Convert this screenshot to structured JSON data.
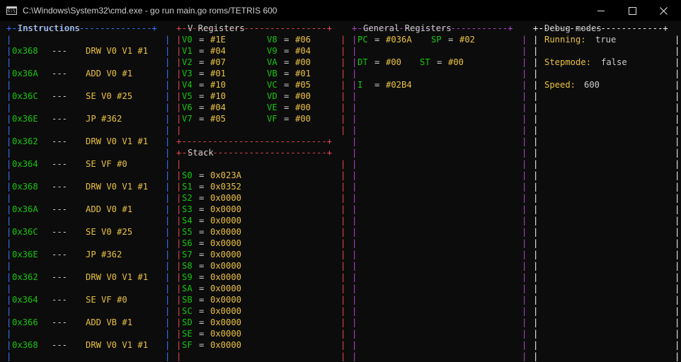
{
  "window": {
    "title": "C:\\Windows\\System32\\cmd.exe - go  run main.go roms/TETRIS 600",
    "icon": "console-icon",
    "icon_glyph": "C:\\",
    "controls": [
      "minimize-icon",
      "maximize-icon",
      "close-icon"
    ]
  },
  "colors": {
    "instructions_border": "#3b78ff",
    "v_registers_border": "#e74856",
    "general_registers_border": "#b148c6",
    "debug_border": "#f2f2f2",
    "address": "#16c60c",
    "value": "#e9c043",
    "text": "#cccccc"
  },
  "instructions": {
    "title": "Instructions",
    "separator": "---",
    "rows": [
      {
        "addr": "0x368",
        "op": "DRW V0 V1 #1"
      },
      {
        "addr": "0x36A",
        "op": "ADD V0 #1"
      },
      {
        "addr": "0x36C",
        "op": "SE V0 #25"
      },
      {
        "addr": "0x36E",
        "op": "JP #362"
      },
      {
        "addr": "0x362",
        "op": "DRW V0 V1 #1"
      },
      {
        "addr": "0x364",
        "op": "SE VF #0"
      },
      {
        "addr": "0x368",
        "op": "DRW V0 V1 #1"
      },
      {
        "addr": "0x36A",
        "op": "ADD V0 #1"
      },
      {
        "addr": "0x36C",
        "op": "SE V0 #25"
      },
      {
        "addr": "0x36E",
        "op": "JP #362"
      },
      {
        "addr": "0x362",
        "op": "DRW V0 V1 #1"
      },
      {
        "addr": "0x364",
        "op": "SE VF #0"
      },
      {
        "addr": "0x366",
        "op": "ADD VB #1"
      },
      {
        "addr": "0x368",
        "op": "DRW V0 V1 #1"
      }
    ]
  },
  "v_registers": {
    "title": "V Registers",
    "left": [
      {
        "name": "V0",
        "value": "#1E"
      },
      {
        "name": "V1",
        "value": "#04"
      },
      {
        "name": "V2",
        "value": "#07"
      },
      {
        "name": "V3",
        "value": "#01"
      },
      {
        "name": "V4",
        "value": "#10"
      },
      {
        "name": "V5",
        "value": "#10"
      },
      {
        "name": "V6",
        "value": "#04"
      },
      {
        "name": "V7",
        "value": "#05"
      }
    ],
    "right": [
      {
        "name": "V8",
        "value": "#06"
      },
      {
        "name": "V9",
        "value": "#04"
      },
      {
        "name": "VA",
        "value": "#00"
      },
      {
        "name": "VB",
        "value": "#01"
      },
      {
        "name": "VC",
        "value": "#05"
      },
      {
        "name": "VD",
        "value": "#00"
      },
      {
        "name": "VE",
        "value": "#00"
      },
      {
        "name": "VF",
        "value": "#00"
      }
    ]
  },
  "stack": {
    "title": "Stack",
    "rows": [
      {
        "name": "S0",
        "value": "0x023A"
      },
      {
        "name": "S1",
        "value": "0x0352"
      },
      {
        "name": "S2",
        "value": "0x0000"
      },
      {
        "name": "S3",
        "value": "0x0000"
      },
      {
        "name": "S4",
        "value": "0x0000"
      },
      {
        "name": "S5",
        "value": "0x0000"
      },
      {
        "name": "S6",
        "value": "0x0000"
      },
      {
        "name": "S7",
        "value": "0x0000"
      },
      {
        "name": "S8",
        "value": "0x0000"
      },
      {
        "name": "S9",
        "value": "0x0000"
      },
      {
        "name": "SA",
        "value": "0x0000"
      },
      {
        "name": "SB",
        "value": "0x0000"
      },
      {
        "name": "SC",
        "value": "0x0000"
      },
      {
        "name": "SD",
        "value": "0x0000"
      },
      {
        "name": "SE",
        "value": "0x0000"
      },
      {
        "name": "SF",
        "value": "0x0000"
      }
    ]
  },
  "general_registers": {
    "title": "General Registers",
    "pc": {
      "name": "PC",
      "value": "#036A"
    },
    "sp": {
      "name": "SP",
      "value": "#02"
    },
    "dt": {
      "name": "DT",
      "value": "#00"
    },
    "st": {
      "name": "ST",
      "value": "#00"
    },
    "i": {
      "name": "I",
      "value": "#02B4"
    }
  },
  "debug": {
    "title": "Debug modes",
    "running": {
      "label": "Running:",
      "value": "true"
    },
    "stepmode": {
      "label": "Stepmode:",
      "value": "false"
    },
    "speed": {
      "label": "Speed:",
      "value": "600"
    }
  }
}
